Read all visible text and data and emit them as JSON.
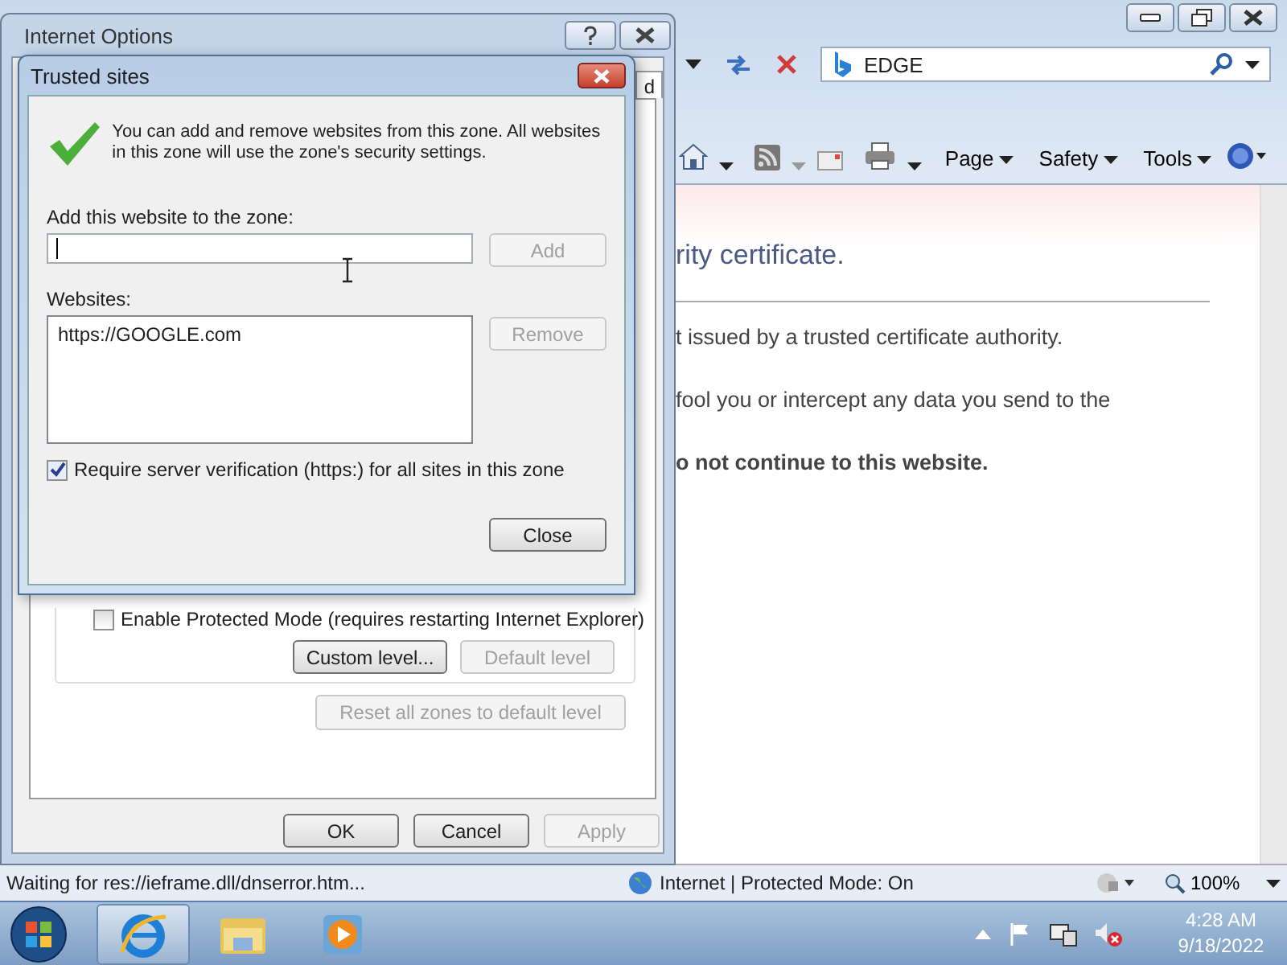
{
  "browser": {
    "search": {
      "value": "EDGE"
    },
    "command_bar": [
      {
        "label": "Page"
      },
      {
        "label": "Safety"
      },
      {
        "label": "Tools"
      }
    ],
    "page": {
      "heading": "rity certificate.",
      "paragraphs": [
        "t issued by a trusted certificate authority.",
        "fool you or intercept any data you send to the"
      ],
      "warning": "o not continue to this website."
    },
    "status_bar": {
      "status": "Waiting for res://ieframe.dll/dnserror.htm...",
      "zone": "Internet | Protected Mode: On",
      "zoom": "100%"
    }
  },
  "internet_options": {
    "title": "Internet Options",
    "tab": "d",
    "protected_mode": {
      "label": "Enable Protected Mode (requires restarting Internet Explorer)",
      "checked": false
    },
    "level_buttons": [
      {
        "label": "Custom level...",
        "disabled": false
      },
      {
        "label": "Default level",
        "disabled": true
      }
    ],
    "reset_button": {
      "label": "Reset all zones to default level",
      "disabled": true
    },
    "dialog_buttons": [
      {
        "label": "OK",
        "disabled": false
      },
      {
        "label": "Cancel",
        "disabled": false
      },
      {
        "label": "Apply",
        "disabled": true
      }
    ]
  },
  "trusted_sites": {
    "title": "Trusted sites",
    "info": "You can add and remove websites from this zone. All websites in this zone will use the zone's security settings.",
    "add_label": "Add this website to the zone:",
    "add_button": {
      "label": "Add",
      "disabled": true
    },
    "websites_label": "Websites:",
    "websites": [
      "https://GOOGLE.com"
    ],
    "remove_button": {
      "label": "Remove",
      "disabled": true
    },
    "require_https": {
      "label": "Require server verification (https:) for all sites in this zone",
      "checked": true
    },
    "close_button": {
      "label": "Close",
      "disabled": false
    }
  },
  "taskbar": {
    "apps": [
      {
        "kind": "ie",
        "active": true
      },
      {
        "kind": "explorer",
        "active": false
      },
      {
        "kind": "media",
        "active": false
      }
    ],
    "time": "4:28 AM",
    "date": "9/18/2022"
  }
}
